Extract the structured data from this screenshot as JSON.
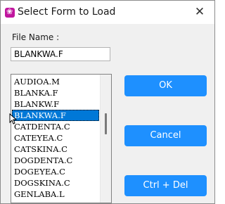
{
  "window": {
    "title": "Select Form to Load",
    "close_glyph": "✕",
    "app_icon": "paw-icon"
  },
  "filename": {
    "label": "File Name :",
    "value": "BLANKWA.F"
  },
  "files": {
    "items": [
      "AUDIOA.M",
      "BLANKA.F",
      "BLANKW.F",
      "BLANKWA.F",
      "CATDENTA.C",
      "CATEYEA.C",
      "CATSKINA.C",
      "DOGDENTA.C",
      "DOGEYEA.C",
      "DOGSKINA.C",
      "GENLABA.L"
    ],
    "selected": "BLANKWA.F"
  },
  "buttons": {
    "ok": "OK",
    "cancel": "Cancel",
    "ctrl_del": "Ctrl + Del"
  },
  "colors": {
    "accent": "#1e90ff",
    "selection": "#0078d7"
  }
}
